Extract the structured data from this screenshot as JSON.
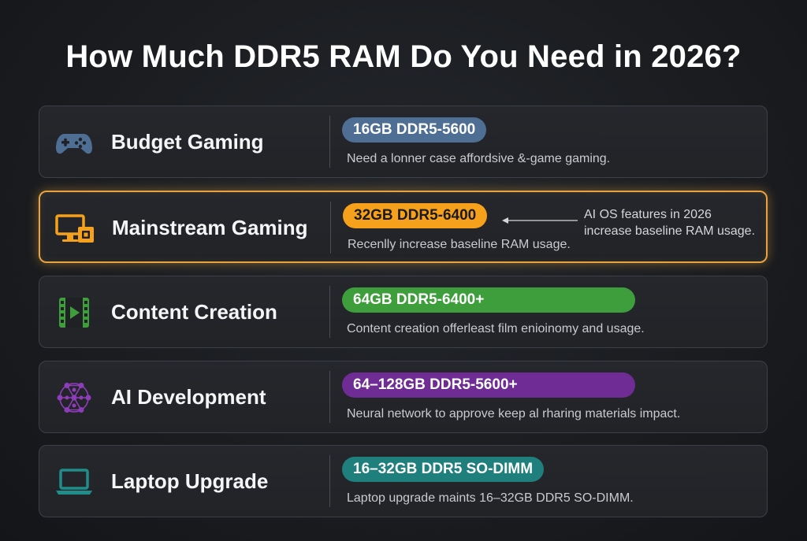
{
  "title": "How Much DDR5 RAM Do You Need in 2026?",
  "colors": {
    "budget": "#4e6e93",
    "mainstream": "#f5a11c",
    "content": "#3f9e3c",
    "ai": "#6f2c95",
    "laptop": "#1f7f7d",
    "highlight_border": "#e7a43e"
  },
  "tiers": [
    {
      "label": "Budget Gaming",
      "icon": "gamepad-icon",
      "spec": "16GB DDR5-5600",
      "description": "Need a lonner case affordsive &-game gaming."
    },
    {
      "label": "Mainstream Gaming",
      "icon": "pc-monitor-icon",
      "spec": "32GB DDR5-6400",
      "description": "Recenlly increase baseline RAM usage.",
      "callout": {
        "line1": "AI OS features in 2026",
        "line2": "increase baseline RAM usage."
      }
    },
    {
      "label": "Content Creation",
      "icon": "video-film-icon",
      "spec": "64GB DDR5-6400+",
      "description": "Content creation offerleast film enioinomy and usage."
    },
    {
      "label": "AI Development",
      "icon": "neural-network-icon",
      "spec": "64–128GB DDR5-5600+",
      "description": "Neural network to approve keep al rharing materials impact."
    },
    {
      "label": "Laptop Upgrade",
      "icon": "laptop-icon",
      "spec": "16–32GB DDR5 SO-DIMM",
      "description": "Laptop upgrade maints 16–32GB DDR5 SO-DIMM."
    }
  ]
}
